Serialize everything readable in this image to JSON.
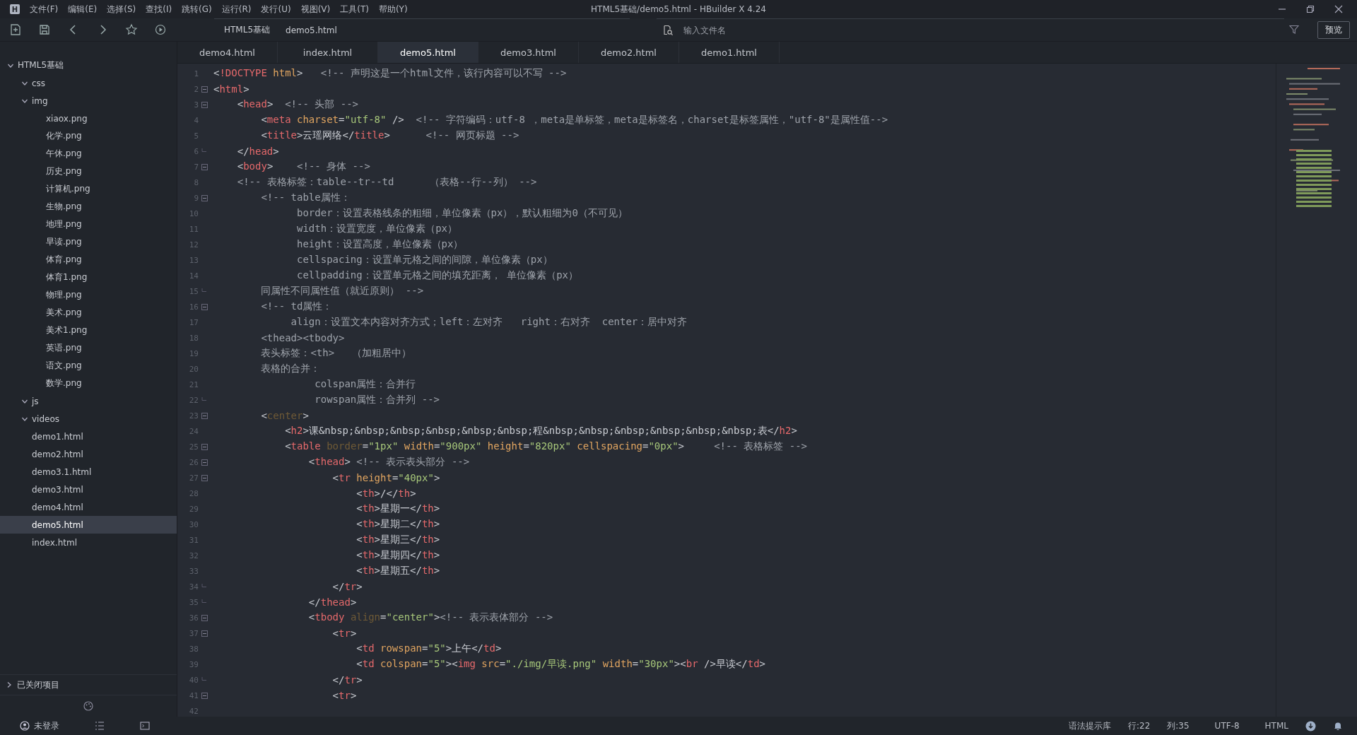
{
  "window": {
    "logo": "H",
    "title": "HTML5基础/demo5.html - HBuilder X 4.24"
  },
  "menu": [
    "文件(F)",
    "编辑(E)",
    "选择(S)",
    "查找(I)",
    "跳转(G)",
    "运行(R)",
    "发行(U)",
    "视图(V)",
    "工具(T)",
    "帮助(Y)"
  ],
  "breadcrumb": [
    "HTML5基础",
    "demo5.html"
  ],
  "file_search": {
    "placeholder": "输入文件名"
  },
  "preview_button": "预览",
  "sidebar": {
    "items": [
      {
        "label": "HTML5基础",
        "expanded": true,
        "selected": false,
        "children": [
          {
            "label": "css",
            "expanded": true,
            "selected": false
          },
          {
            "label": "img",
            "expanded": true,
            "selected": false,
            "children": [
              {
                "label": "xiaox.png",
                "selected": false
              },
              {
                "label": "化学.png",
                "selected": false
              },
              {
                "label": "午休.png",
                "selected": false
              },
              {
                "label": "历史.png",
                "selected": false
              },
              {
                "label": "计算机.png",
                "selected": false
              },
              {
                "label": "生物.png",
                "selected": false
              },
              {
                "label": "地理.png",
                "selected": false
              },
              {
                "label": "早读.png",
                "selected": false
              },
              {
                "label": "体育.png",
                "selected": false
              },
              {
                "label": "体育1.png",
                "selected": false
              },
              {
                "label": "物理.png",
                "selected": false
              },
              {
                "label": "美术.png",
                "selected": false
              },
              {
                "label": "美术1.png",
                "selected": false
              },
              {
                "label": "英语.png",
                "selected": false
              },
              {
                "label": "语文.png",
                "selected": false
              },
              {
                "label": "数学.png",
                "selected": false
              }
            ]
          },
          {
            "label": "js",
            "expanded": true,
            "selected": false
          },
          {
            "label": "videos",
            "expanded": true,
            "selected": false
          },
          {
            "label": "demo1.html",
            "selected": false
          },
          {
            "label": "demo2.html",
            "selected": false
          },
          {
            "label": "demo3.1.html",
            "selected": false
          },
          {
            "label": "demo3.html",
            "selected": false
          },
          {
            "label": "demo4.html",
            "selected": false
          },
          {
            "label": "demo5.html",
            "selected": true
          },
          {
            "label": "index.html",
            "selected": false
          }
        ]
      }
    ],
    "closed_projects": {
      "label": "已关闭项目",
      "expanded": false
    }
  },
  "tabs": [
    {
      "label": "demo4.html",
      "selected": false
    },
    {
      "label": "index.html",
      "selected": false
    },
    {
      "label": "demo5.html",
      "selected": true
    },
    {
      "label": "demo3.html",
      "selected": false
    },
    {
      "label": "demo2.html",
      "selected": false
    },
    {
      "label": "demo1.html",
      "selected": false
    }
  ],
  "editor": {
    "lines": [
      {
        "n": "1",
        "kind": "plain",
        "tokens": [
          {
            "kind": "p",
            "text": "<"
          },
          {
            "kind": "t",
            "text": "!DOCTYPE"
          },
          {
            "kind": "a",
            "text": " html"
          },
          {
            "kind": "p",
            "text": ">"
          },
          {
            "kind": "c",
            "text": "   <!-- 声明这是一个html文件，该行内容可以不写 -->"
          }
        ]
      },
      {
        "n": "2",
        "kind": "fold_start",
        "tokens": [
          {
            "kind": "p",
            "text": "<"
          },
          {
            "kind": "t",
            "text": "html"
          },
          {
            "kind": "p",
            "text": ">"
          }
        ]
      },
      {
        "n": "3",
        "kind": "fold_start",
        "tokens": [
          {
            "kind": "p",
            "text": "    <"
          },
          {
            "kind": "t",
            "text": "head"
          },
          {
            "kind": "p",
            "text": ">"
          },
          {
            "kind": "c",
            "text": "  <!-- 头部 -->"
          }
        ]
      },
      {
        "n": "4",
        "kind": "plain",
        "tokens": [
          {
            "kind": "p",
            "text": "        <"
          },
          {
            "kind": "t",
            "text": "meta"
          },
          {
            "kind": "a",
            "text": " charset"
          },
          {
            "kind": "p",
            "text": "="
          },
          {
            "kind": "s",
            "text": "\"utf-8\""
          },
          {
            "kind": "p",
            "text": " />"
          },
          {
            "kind": "c",
            "text": "  <!-- 字符编码：utf-8 ，meta是单标签，meta是标签名，charset是标签属性，\"utf-8\"是属性值-->"
          }
        ]
      },
      {
        "n": "5",
        "kind": "plain",
        "tokens": [
          {
            "kind": "p",
            "text": "        <"
          },
          {
            "kind": "t",
            "text": "title"
          },
          {
            "kind": "p",
            "text": ">"
          },
          {
            "kind": "x",
            "text": "云瑶网络"
          },
          {
            "kind": "p",
            "text": "</"
          },
          {
            "kind": "t",
            "text": "title"
          },
          {
            "kind": "p",
            "text": ">"
          },
          {
            "kind": "c",
            "text": "      <!-- 网页标题 -->"
          }
        ]
      },
      {
        "n": "6",
        "kind": "fold_end",
        "tokens": [
          {
            "kind": "p",
            "text": "    </"
          },
          {
            "kind": "t",
            "text": "head"
          },
          {
            "kind": "p",
            "text": ">"
          }
        ]
      },
      {
        "n": "7",
        "kind": "fold_start",
        "tokens": [
          {
            "kind": "p",
            "text": "    <"
          },
          {
            "kind": "t",
            "text": "body"
          },
          {
            "kind": "p",
            "text": ">"
          },
          {
            "kind": "c",
            "text": "    <!-- 身体 -->"
          }
        ]
      },
      {
        "n": "8",
        "kind": "plain",
        "tokens": [
          {
            "kind": "c",
            "text": "    <!-- 表格标签：table--tr--td      （表格--行--列） -->"
          }
        ]
      },
      {
        "n": "9",
        "kind": "fold_start",
        "tokens": [
          {
            "kind": "c",
            "text": "        <!-- table属性："
          }
        ]
      },
      {
        "n": "10",
        "kind": "plain",
        "tokens": [
          {
            "kind": "c",
            "text": "              border：设置表格线条的粗细，单位像素（px），默认粗细为0（不可见）"
          }
        ]
      },
      {
        "n": "11",
        "kind": "plain",
        "tokens": [
          {
            "kind": "c",
            "text": "              width：设置宽度，单位像素（px）"
          }
        ]
      },
      {
        "n": "12",
        "kind": "plain",
        "tokens": [
          {
            "kind": "c",
            "text": "              height：设置高度，单位像素（px）"
          }
        ]
      },
      {
        "n": "13",
        "kind": "plain",
        "tokens": [
          {
            "kind": "c",
            "text": "              cellspacing：设置单元格之间的间隙，单位像素（px）"
          }
        ]
      },
      {
        "n": "14",
        "kind": "plain",
        "tokens": [
          {
            "kind": "c",
            "text": "              cellpadding：设置单元格之间的填充距离， 单位像素（px）"
          }
        ]
      },
      {
        "n": "15",
        "kind": "fold_end",
        "tokens": [
          {
            "kind": "c",
            "text": "        同属性不同属性值（就近原则） -->"
          }
        ]
      },
      {
        "n": "16",
        "kind": "fold_start",
        "tokens": [
          {
            "kind": "c",
            "text": "        <!-- td属性："
          }
        ]
      },
      {
        "n": "17",
        "kind": "plain",
        "tokens": [
          {
            "kind": "c",
            "text": "             align：设置文本内容对齐方式；left：左对齐   right：右对齐  center：居中对齐"
          }
        ]
      },
      {
        "n": "18",
        "kind": "plain",
        "tokens": [
          {
            "kind": "c",
            "text": "        <thead><tbody>"
          }
        ]
      },
      {
        "n": "19",
        "kind": "plain",
        "tokens": [
          {
            "kind": "c",
            "text": "        表头标签：<th>   （加粗居中）"
          }
        ]
      },
      {
        "n": "20",
        "kind": "plain",
        "tokens": [
          {
            "kind": "c",
            "text": "        表格的合并："
          }
        ]
      },
      {
        "n": "21",
        "kind": "plain",
        "tokens": [
          {
            "kind": "c",
            "text": "                 colspan属性：合并行"
          }
        ]
      },
      {
        "n": "22",
        "kind": "fold_end",
        "tokens": [
          {
            "kind": "c",
            "text": "                 rowspan属性：合并列 -->"
          }
        ]
      },
      {
        "n": "23",
        "kind": "fold_start",
        "tokens": [
          {
            "kind": "p",
            "text": "        <"
          },
          {
            "kind": "d",
            "text": "center"
          },
          {
            "kind": "p",
            "text": ">"
          }
        ]
      },
      {
        "n": "24",
        "kind": "plain",
        "tokens": [
          {
            "kind": "p",
            "text": "            <"
          },
          {
            "kind": "t",
            "text": "h2"
          },
          {
            "kind": "p",
            "text": ">"
          },
          {
            "kind": "x",
            "text": "课&nbsp;&nbsp;&nbsp;&nbsp;&nbsp;&nbsp;程&nbsp;&nbsp;&nbsp;&nbsp;&nbsp;&nbsp;表"
          },
          {
            "kind": "p",
            "text": "</"
          },
          {
            "kind": "t",
            "text": "h2"
          },
          {
            "kind": "p",
            "text": ">"
          }
        ]
      },
      {
        "n": "25",
        "kind": "fold_start",
        "tokens": [
          {
            "kind": "p",
            "text": "            <"
          },
          {
            "kind": "t",
            "text": "table"
          },
          {
            "kind": "d",
            "text": " border"
          },
          {
            "kind": "p",
            "text": "="
          },
          {
            "kind": "s",
            "text": "\"1px\""
          },
          {
            "kind": "a",
            "text": " width"
          },
          {
            "kind": "p",
            "text": "="
          },
          {
            "kind": "s",
            "text": "\"900px\""
          },
          {
            "kind": "a",
            "text": " height"
          },
          {
            "kind": "p",
            "text": "="
          },
          {
            "kind": "s",
            "text": "\"820px\""
          },
          {
            "kind": "a",
            "text": " cellspacing"
          },
          {
            "kind": "p",
            "text": "="
          },
          {
            "kind": "s",
            "text": "\"0px\""
          },
          {
            "kind": "p",
            "text": ">"
          },
          {
            "kind": "c",
            "text": "     <!-- 表格标签 -->"
          }
        ]
      },
      {
        "n": "26",
        "kind": "fold_start",
        "tokens": [
          {
            "kind": "p",
            "text": "                <"
          },
          {
            "kind": "t",
            "text": "thead"
          },
          {
            "kind": "p",
            "text": ">"
          },
          {
            "kind": "c",
            "text": " <!-- 表示表头部分 -->"
          }
        ]
      },
      {
        "n": "27",
        "kind": "fold_start",
        "tokens": [
          {
            "kind": "p",
            "text": "                    <"
          },
          {
            "kind": "t",
            "text": "tr"
          },
          {
            "kind": "a",
            "text": " height"
          },
          {
            "kind": "p",
            "text": "="
          },
          {
            "kind": "s",
            "text": "\"40px\""
          },
          {
            "kind": "p",
            "text": ">"
          }
        ]
      },
      {
        "n": "28",
        "kind": "plain",
        "tokens": [
          {
            "kind": "p",
            "text": "                        <"
          },
          {
            "kind": "t",
            "text": "th"
          },
          {
            "kind": "p",
            "text": ">"
          },
          {
            "kind": "x",
            "text": "/"
          },
          {
            "kind": "p",
            "text": "</"
          },
          {
            "kind": "t",
            "text": "th"
          },
          {
            "kind": "p",
            "text": ">"
          }
        ]
      },
      {
        "n": "29",
        "kind": "plain",
        "tokens": [
          {
            "kind": "p",
            "text": "                        <"
          },
          {
            "kind": "t",
            "text": "th"
          },
          {
            "kind": "p",
            "text": ">"
          },
          {
            "kind": "x",
            "text": "星期一"
          },
          {
            "kind": "p",
            "text": "</"
          },
          {
            "kind": "t",
            "text": "th"
          },
          {
            "kind": "p",
            "text": ">"
          }
        ]
      },
      {
        "n": "30",
        "kind": "plain",
        "tokens": [
          {
            "kind": "p",
            "text": "                        <"
          },
          {
            "kind": "t",
            "text": "th"
          },
          {
            "kind": "p",
            "text": ">"
          },
          {
            "kind": "x",
            "text": "星期二"
          },
          {
            "kind": "p",
            "text": "</"
          },
          {
            "kind": "t",
            "text": "th"
          },
          {
            "kind": "p",
            "text": ">"
          }
        ]
      },
      {
        "n": "31",
        "kind": "plain",
        "tokens": [
          {
            "kind": "p",
            "text": "                        <"
          },
          {
            "kind": "t",
            "text": "th"
          },
          {
            "kind": "p",
            "text": ">"
          },
          {
            "kind": "x",
            "text": "星期三"
          },
          {
            "kind": "p",
            "text": "</"
          },
          {
            "kind": "t",
            "text": "th"
          },
          {
            "kind": "p",
            "text": ">"
          }
        ]
      },
      {
        "n": "32",
        "kind": "plain",
        "tokens": [
          {
            "kind": "p",
            "text": "                        <"
          },
          {
            "kind": "t",
            "text": "th"
          },
          {
            "kind": "p",
            "text": ">"
          },
          {
            "kind": "x",
            "text": "星期四"
          },
          {
            "kind": "p",
            "text": "</"
          },
          {
            "kind": "t",
            "text": "th"
          },
          {
            "kind": "p",
            "text": ">"
          }
        ]
      },
      {
        "n": "33",
        "kind": "plain",
        "tokens": [
          {
            "kind": "p",
            "text": "                        <"
          },
          {
            "kind": "t",
            "text": "th"
          },
          {
            "kind": "p",
            "text": ">"
          },
          {
            "kind": "x",
            "text": "星期五"
          },
          {
            "kind": "p",
            "text": "</"
          },
          {
            "kind": "t",
            "text": "th"
          },
          {
            "kind": "p",
            "text": ">"
          }
        ]
      },
      {
        "n": "34",
        "kind": "fold_end",
        "tokens": [
          {
            "kind": "p",
            "text": "                    </"
          },
          {
            "kind": "t",
            "text": "tr"
          },
          {
            "kind": "p",
            "text": ">"
          }
        ]
      },
      {
        "n": "35",
        "kind": "fold_end",
        "tokens": [
          {
            "kind": "p",
            "text": "                </"
          },
          {
            "kind": "t",
            "text": "thead"
          },
          {
            "kind": "p",
            "text": ">"
          }
        ]
      },
      {
        "n": "36",
        "kind": "fold_start",
        "tokens": [
          {
            "kind": "p",
            "text": "                <"
          },
          {
            "kind": "t",
            "text": "tbody"
          },
          {
            "kind": "d",
            "text": " align"
          },
          {
            "kind": "p",
            "text": "="
          },
          {
            "kind": "s",
            "text": "\"center\""
          },
          {
            "kind": "p",
            "text": ">"
          },
          {
            "kind": "c",
            "text": "<!-- 表示表体部分 -->"
          }
        ]
      },
      {
        "n": "37",
        "kind": "fold_start",
        "tokens": [
          {
            "kind": "p",
            "text": "                    <"
          },
          {
            "kind": "t",
            "text": "tr"
          },
          {
            "kind": "p",
            "text": ">"
          }
        ]
      },
      {
        "n": "38",
        "kind": "plain",
        "tokens": [
          {
            "kind": "p",
            "text": "                        <"
          },
          {
            "kind": "t",
            "text": "td"
          },
          {
            "kind": "a",
            "text": " rowspan"
          },
          {
            "kind": "p",
            "text": "="
          },
          {
            "kind": "s",
            "text": "\"5\""
          },
          {
            "kind": "p",
            "text": ">"
          },
          {
            "kind": "x",
            "text": "上午"
          },
          {
            "kind": "p",
            "text": "</"
          },
          {
            "kind": "t",
            "text": "td"
          },
          {
            "kind": "p",
            "text": ">"
          }
        ]
      },
      {
        "n": "39",
        "kind": "plain",
        "tokens": [
          {
            "kind": "p",
            "text": "                        <"
          },
          {
            "kind": "t",
            "text": "td"
          },
          {
            "kind": "a",
            "text": " colspan"
          },
          {
            "kind": "p",
            "text": "="
          },
          {
            "kind": "s",
            "text": "\"5\""
          },
          {
            "kind": "p",
            "text": ">"
          },
          {
            "kind": "p",
            "text": "<"
          },
          {
            "kind": "t",
            "text": "img"
          },
          {
            "kind": "a",
            "text": " src"
          },
          {
            "kind": "p",
            "text": "="
          },
          {
            "kind": "s",
            "text": "\"./img/早读.png\""
          },
          {
            "kind": "a",
            "text": " width"
          },
          {
            "kind": "p",
            "text": "="
          },
          {
            "kind": "s",
            "text": "\"30px\""
          },
          {
            "kind": "p",
            "text": ">"
          },
          {
            "kind": "p",
            "text": "<"
          },
          {
            "kind": "t",
            "text": "br"
          },
          {
            "kind": "p",
            "text": " />"
          },
          {
            "kind": "x",
            "text": "早读"
          },
          {
            "kind": "p",
            "text": "</"
          },
          {
            "kind": "t",
            "text": "td"
          },
          {
            "kind": "p",
            "text": ">"
          }
        ]
      },
      {
        "n": "40",
        "kind": "fold_end",
        "tokens": [
          {
            "kind": "p",
            "text": "                    </"
          },
          {
            "kind": "t",
            "text": "tr"
          },
          {
            "kind": "p",
            "text": ">"
          }
        ]
      },
      {
        "n": "41",
        "kind": "fold_start",
        "tokens": [
          {
            "kind": "p",
            "text": "                    <"
          },
          {
            "kind": "t",
            "text": "tr"
          },
          {
            "kind": "p",
            "text": ">"
          }
        ]
      },
      {
        "n": "42",
        "kind": "plain"
      }
    ]
  },
  "status_bar": {
    "user": "未登录",
    "syntax": "语法提示库",
    "line": "行:22",
    "column": "列:35",
    "encoding": "UTF-8",
    "language": "HTML"
  }
}
